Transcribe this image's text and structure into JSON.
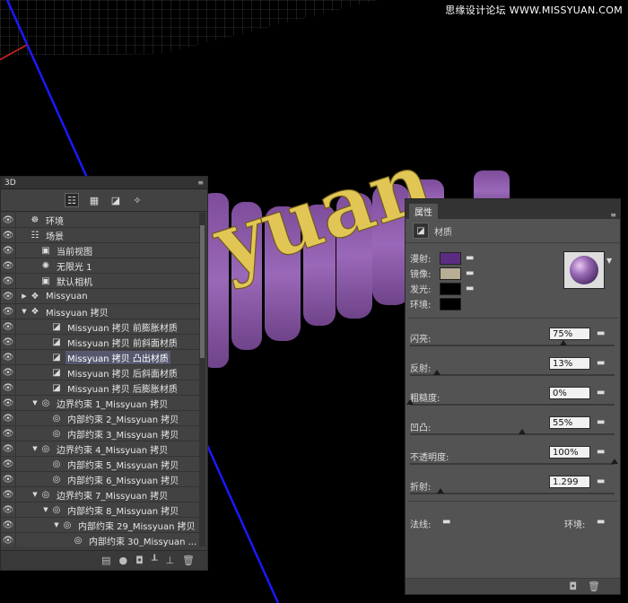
{
  "watermark": "思缘设计论坛 WWW.MISSYUAN.COM",
  "canvas": {
    "text_3d": "yuan",
    "text_color": "#e6c95a",
    "extrude_color": "#8b59a8"
  },
  "panel3d": {
    "title": "3D",
    "menu": "≡",
    "toolbar_icons": [
      "scene-filter-icon",
      "mesh-filter-icon",
      "material-filter-icon",
      "light-filter-icon"
    ],
    "rows": [
      {
        "label": "环境",
        "icon": "☸",
        "icon_name": "environment-icon",
        "indent": 0,
        "twist": ""
      },
      {
        "label": "场景",
        "icon": "☷",
        "icon_name": "scene-icon",
        "indent": 0,
        "twist": ""
      },
      {
        "label": "当前视图",
        "icon": "▣",
        "icon_name": "camera-view-icon",
        "indent": 1,
        "twist": ""
      },
      {
        "label": "无限光 1",
        "icon": "✺",
        "icon_name": "infinite-light-icon",
        "indent": 1,
        "twist": ""
      },
      {
        "label": "默认相机",
        "icon": "▣",
        "icon_name": "camera-icon",
        "indent": 1,
        "twist": ""
      },
      {
        "label": "Missyuan",
        "icon": "❖",
        "icon_name": "mesh-icon",
        "indent": 0,
        "twist": "▶"
      },
      {
        "label": "Missyuan 拷贝",
        "icon": "❖",
        "icon_name": "mesh-icon",
        "indent": 0,
        "twist": "▼"
      },
      {
        "label": "Missyuan 拷贝 前膨胀材质",
        "icon": "◪",
        "icon_name": "material-icon",
        "indent": 2,
        "twist": ""
      },
      {
        "label": "Missyuan 拷贝 前斜面材质",
        "icon": "◪",
        "icon_name": "material-icon",
        "indent": 2,
        "twist": ""
      },
      {
        "label": "Missyuan 拷贝 凸出材质",
        "icon": "◪",
        "icon_name": "material-icon",
        "indent": 2,
        "twist": "",
        "selected": true
      },
      {
        "label": "Missyuan 拷贝 后斜面材质",
        "icon": "◪",
        "icon_name": "material-icon",
        "indent": 2,
        "twist": ""
      },
      {
        "label": "Missyuan 拷贝 后膨胀材质",
        "icon": "◪",
        "icon_name": "material-icon",
        "indent": 2,
        "twist": ""
      },
      {
        "label": "边界约束 1_Missyuan 拷贝",
        "icon": "◎",
        "icon_name": "constraint-icon",
        "indent": 1,
        "twist": "▼"
      },
      {
        "label": "内部约束 2_Missyuan 拷贝",
        "icon": "◎",
        "icon_name": "constraint-icon",
        "indent": 2,
        "twist": ""
      },
      {
        "label": "内部约束 3_Missyuan 拷贝",
        "icon": "◎",
        "icon_name": "constraint-icon",
        "indent": 2,
        "twist": ""
      },
      {
        "label": "边界约束 4_Missyuan 拷贝",
        "icon": "◎",
        "icon_name": "constraint-icon",
        "indent": 1,
        "twist": "▼"
      },
      {
        "label": "内部约束 5_Missyuan 拷贝",
        "icon": "◎",
        "icon_name": "constraint-icon",
        "indent": 2,
        "twist": ""
      },
      {
        "label": "内部约束 6_Missyuan 拷贝",
        "icon": "◎",
        "icon_name": "constraint-icon",
        "indent": 2,
        "twist": ""
      },
      {
        "label": "边界约束 7_Missyuan 拷贝",
        "icon": "◎",
        "icon_name": "constraint-icon",
        "indent": 1,
        "twist": "▼"
      },
      {
        "label": "内部约束 8_Missyuan 拷贝",
        "icon": "◎",
        "icon_name": "constraint-icon",
        "indent": 2,
        "twist": "▼"
      },
      {
        "label": "内部约束 29_Missyuan 拷贝",
        "icon": "◎",
        "icon_name": "constraint-icon",
        "indent": 3,
        "twist": "▼"
      },
      {
        "label": "内部约束 30_Missyuan ...",
        "icon": "◎",
        "icon_name": "constraint-icon",
        "indent": 4,
        "twist": ""
      }
    ],
    "bottom_icons": [
      "▤",
      "●",
      "◘",
      "┸",
      "⊥",
      "🗑"
    ]
  },
  "properties": {
    "tab": "属性",
    "header_label": "材质",
    "swatches": [
      {
        "label": "漫射:",
        "color": "#5a2d83"
      },
      {
        "label": "镜像:",
        "color": "#b8ad95"
      },
      {
        "label": "发光:",
        "color": "#000000"
      },
      {
        "label": "环境:",
        "color": "#000000"
      }
    ],
    "params": [
      {
        "label": "闪亮:",
        "value": "75%",
        "level": 0.75
      },
      {
        "label": "反射:",
        "value": "13%",
        "level": 0.13
      },
      {
        "label": "粗糙度:",
        "value": "0%",
        "level": 0.0
      },
      {
        "label": "凹凸:",
        "value": "55%",
        "level": 0.55
      },
      {
        "label": "不透明度:",
        "value": "100%",
        "level": 1.0
      },
      {
        "label": "折射:",
        "value": "1.299",
        "level": 0.15
      }
    ],
    "normal_label": "法线:",
    "env_label": "环境:"
  }
}
